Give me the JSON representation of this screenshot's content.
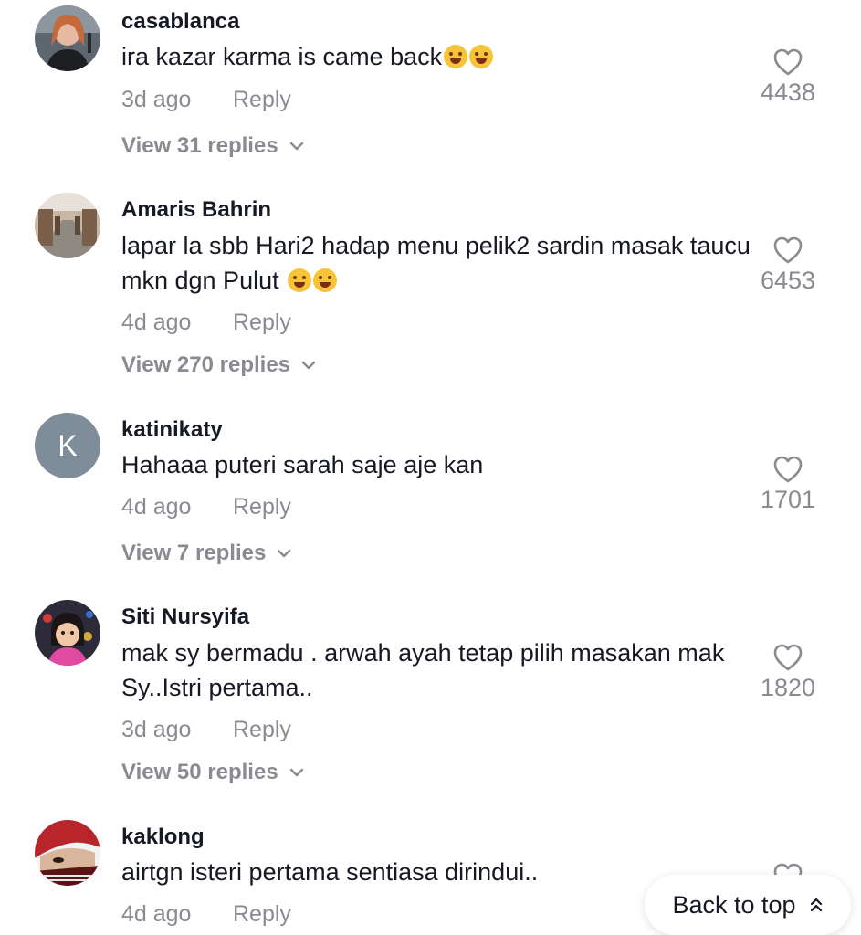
{
  "comments": [
    {
      "username": "casablanca",
      "text": "ira kazar karma is came back",
      "emoji_count": 2,
      "time": "3d ago",
      "reply_label": "Reply",
      "likes": "4438",
      "view_replies": "View 31 replies"
    },
    {
      "username": "Amaris Bahrin",
      "text": "lapar la sbb Hari2 hadap menu pelik2 sardin masak taucu mkn dgn Pulut",
      "emoji_count": 2,
      "time": "4d ago",
      "reply_label": "Reply",
      "likes": "6453",
      "view_replies": "View 270 replies"
    },
    {
      "username": "katinikaty",
      "avatar_letter": "K",
      "text": "Hahaaa puteri sarah saje aje kan",
      "time": "4d ago",
      "reply_label": "Reply",
      "likes": "1701",
      "view_replies": "View 7 replies"
    },
    {
      "username": "Siti Nursyifa",
      "text": "mak sy bermadu . arwah ayah tetap pilih masakan mak Sy..Istri pertama..",
      "time": "3d ago",
      "reply_label": "Reply",
      "likes": "1820",
      "view_replies": "View 50 replies"
    },
    {
      "username": "kaklong",
      "text": "airtgn isteri pertama sentiasa dirindui..",
      "time": "4d ago",
      "reply_label": "Reply"
    }
  ],
  "back_to_top": "Back to top",
  "colors": {
    "text": "#161823",
    "secondary": "#8a8b91",
    "avatar_letter_bg": "#7f8c99"
  }
}
